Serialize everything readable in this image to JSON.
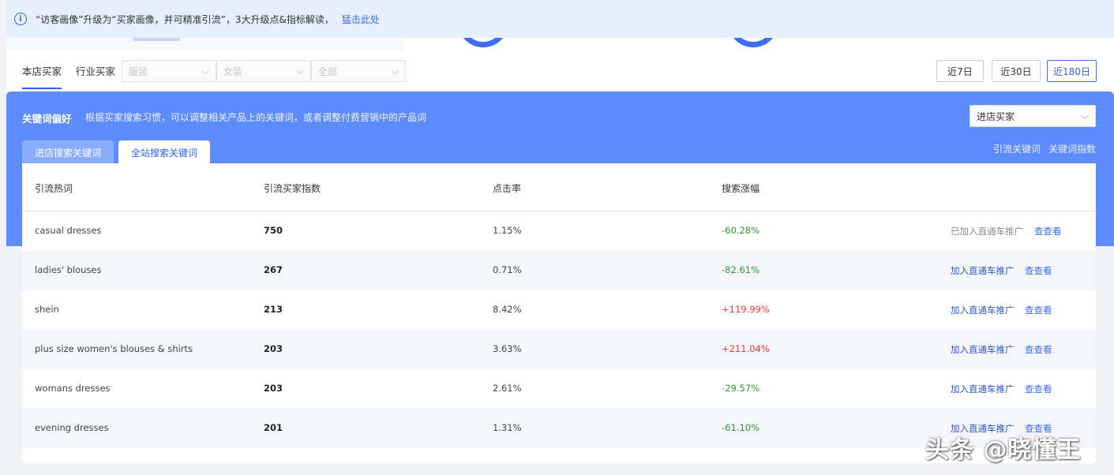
{
  "notice": {
    "icon": "info-icon",
    "text": "“访客画像”升级为“买家画像，并可精准引流”，3大升级点&指标解读，",
    "link": "猛击此处"
  },
  "filters": {
    "tabs": [
      "本店买家",
      "行业买家"
    ],
    "selects": [
      "服装",
      "女装",
      "全部"
    ],
    "ranges": [
      "近7日",
      "近30日",
      "近180日"
    ],
    "active_range": "近180日"
  },
  "panel": {
    "title": "关键词偏好",
    "desc": "根据买家搜索习惯，可以调整相关产品上的关键词，或者调整付费营销中的产品词",
    "select_value": "进店买家",
    "sub_tabs": [
      "进店搜索关键词",
      "全站搜索关键词"
    ],
    "links": [
      "引流关键词",
      "关键词指数"
    ]
  },
  "table": {
    "headers": [
      "引流热词",
      "引流买家指数",
      "点击率",
      "搜索涨幅"
    ],
    "rows": [
      {
        "keyword": "casual dresses",
        "index": "750",
        "ctr": "1.15%",
        "growth": "-60.28%",
        "action": "已加入直通车推广",
        "added": true,
        "view": "查查看"
      },
      {
        "keyword": "ladies' blouses",
        "index": "267",
        "ctr": "0.71%",
        "growth": "-82.61%",
        "action": "加入直通车推广",
        "added": false,
        "view": "查查看"
      },
      {
        "keyword": "shein",
        "index": "213",
        "ctr": "8.42%",
        "growth": "+119.99%",
        "action": "加入直通车推广",
        "added": false,
        "view": "查查看"
      },
      {
        "keyword": "plus size women's blouses & shirts",
        "index": "203",
        "ctr": "3.63%",
        "growth": "+211.04%",
        "action": "加入直通车推广",
        "added": false,
        "view": "查查看"
      },
      {
        "keyword": "womans dresses",
        "index": "203",
        "ctr": "2.61%",
        "growth": "-29.57%",
        "action": "加入直通车推广",
        "added": false,
        "view": "查查看"
      },
      {
        "keyword": "evening dresses",
        "index": "201",
        "ctr": "1.31%",
        "growth": "-61.10%",
        "action": "加入直通车推广",
        "added": false,
        "view": "查查看"
      }
    ]
  },
  "watermark": "头条 @晓懂王",
  "colors": {
    "accent": "#3e6ef2",
    "panel": "#5e8cff",
    "up": "#f0333a",
    "down": "#2f9a2f"
  }
}
